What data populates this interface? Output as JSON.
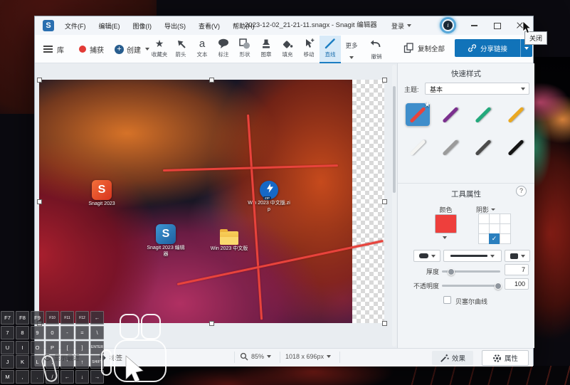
{
  "titlebar": {
    "title": "2023-12-02_21-21-11.snagx - Snagit 编辑器",
    "menus": [
      "文件(F)",
      "编辑(E)",
      "图像(I)",
      "导出(S)",
      "查看(V)",
      "帮助(H)"
    ],
    "sign_in": "登录",
    "close_tooltip": "关闭"
  },
  "toolbar": {
    "library": "库",
    "capture": "捕获",
    "create": "创建",
    "tools": [
      {
        "name": "favorites",
        "icon": "star-icon",
        "label": "收藏夹"
      },
      {
        "name": "arrow",
        "icon": "arrow-icon",
        "label": "箭头"
      },
      {
        "name": "text",
        "icon": "text-icon",
        "label": "文本"
      },
      {
        "name": "callout",
        "icon": "callout-icon",
        "label": "标注"
      },
      {
        "name": "shape",
        "icon": "shape-icon",
        "label": "形状"
      },
      {
        "name": "stamp",
        "icon": "stamp-icon",
        "label": "图章"
      },
      {
        "name": "fill",
        "icon": "fill-bucket-icon",
        "label": "填充"
      },
      {
        "name": "move",
        "icon": "move-cursor-icon",
        "label": "移动"
      },
      {
        "name": "line",
        "icon": "line-icon",
        "label": "直线",
        "selected": true
      },
      {
        "name": "more",
        "icon": "chevron-down-icon",
        "label": "更多"
      }
    ],
    "undo": "撤销",
    "copy_all": "复制全部",
    "share_link": "分享链接"
  },
  "quick_styles": {
    "title": "快速样式",
    "theme_label": "主题:",
    "theme_value": "基本",
    "swatches": [
      {
        "color": "#e8433c",
        "selected": true
      },
      {
        "color": "#7b2f8e"
      },
      {
        "color": "#23a97c"
      },
      {
        "color": "#eaa821"
      },
      {
        "color": "#f4f4f2"
      },
      {
        "color": "#9b9b9b"
      },
      {
        "color": "#4b4b4b"
      },
      {
        "color": "#141414"
      }
    ]
  },
  "tool_properties": {
    "title": "工具属性",
    "color_label": "颜色",
    "color_value": "#ee3f3c",
    "shadow_label": "阴影",
    "thickness_label": "厚度",
    "thickness_value": "7",
    "opacity_label": "不透明度",
    "opacity_value": "100",
    "bezier_label": "贝塞尔曲线"
  },
  "statusbar": {
    "show_recent": "显示最近",
    "tags": "标签",
    "zoom_level": "85%",
    "canvas_size": "1018 x 696px",
    "effects": "效果",
    "properties": "属性"
  },
  "canvas": {
    "annotation_color": "#e8433c",
    "desktop_icons": [
      {
        "label": "Snagit 2023"
      },
      {
        "label": "Win 2023 中文版.zip"
      },
      {
        "label": "Snagit 2023 编辑器"
      },
      {
        "label": "Win 2023 中文版"
      }
    ]
  },
  "keyboard": {
    "rows": [
      [
        "F7",
        "F8",
        "F9",
        "F10",
        "F11",
        "F12",
        "←"
      ],
      [
        "7",
        "8",
        "9",
        "0",
        "-",
        "=",
        "\\"
      ],
      [
        "U",
        "I",
        "O",
        "P",
        "[",
        "]",
        "ENTER"
      ],
      [
        "J",
        "K",
        "L",
        ";",
        "'",
        "↑",
        "SHIFT"
      ],
      [
        "M",
        ",",
        ".",
        "/",
        "←",
        "↓",
        "→"
      ]
    ]
  },
  "colors": {
    "accent_blue": "#1c7ec2",
    "share_button_blue": "#1173b9",
    "selected_swatch_bg": "#3f8ecb",
    "annotation_red": "#e8433c"
  }
}
